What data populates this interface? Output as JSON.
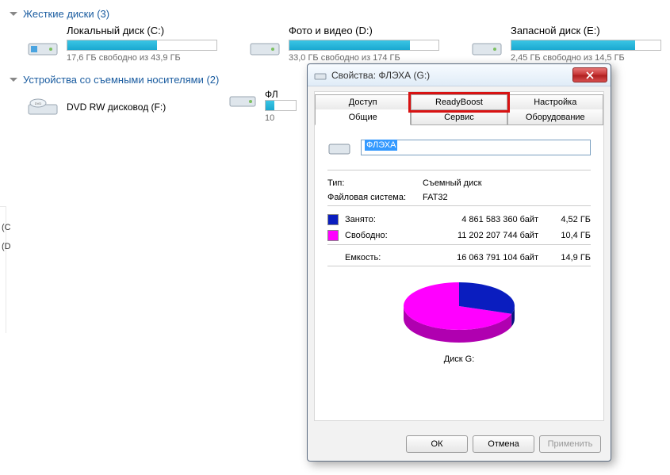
{
  "sections": {
    "hdd_header": "Жесткие диски (3)",
    "removable_header": "Устройства со съемными носителями (2)"
  },
  "drives": [
    {
      "label": "Локальный диск (C:)",
      "free": "17,6 ГБ свободно из 43,9 ГБ",
      "fill": 60
    },
    {
      "label": "Фото и видео (D:)",
      "free": "33,0 ГБ свободно из 174 ГБ",
      "fill": 81
    },
    {
      "label": "Запасной диск (E:)",
      "free": "2,45 ГБ свободно из 14,5 ГБ",
      "fill": 83
    }
  ],
  "dvd": {
    "label": "DVD RW дисковод (F:)"
  },
  "flash_bg": {
    "label_short": "ФЛ",
    "free_short": "10"
  },
  "left_letters": {
    "c": "(C",
    "d": "(D"
  },
  "dialog": {
    "title": "Свойства: ФЛЭХА (G:)",
    "tabs_row1": [
      "Доступ",
      "ReadyBoost",
      "Настройка"
    ],
    "tabs_row2": [
      "Общие",
      "Сервис",
      "Оборудование"
    ],
    "name_value": "ФЛЭХА",
    "type_label": "Тип:",
    "type_value": "Съемный диск",
    "fs_label": "Файловая система:",
    "fs_value": "FAT32",
    "used_label": "Занято:",
    "used_bytes": "4 861 583 360 байт",
    "used_gb": "4,52 ГБ",
    "free_label": "Свободно:",
    "free_bytes": "11 202 207 744 байт",
    "free_gb": "10,4 ГБ",
    "cap_label": "Емкость:",
    "cap_bytes": "16 063 791 104 байт",
    "cap_gb": "14,9 ГБ",
    "pie_label": "Диск G:",
    "buttons": {
      "ok": "ОК",
      "cancel": "Отмена",
      "apply": "Применить"
    }
  },
  "colors": {
    "used": "#0a1dbf",
    "free": "#ff00ff"
  },
  "chart_data": {
    "type": "pie",
    "title": "Диск G:",
    "series": [
      {
        "name": "Занято",
        "value": 4861583360,
        "value_gb": 4.52,
        "color": "#0a1dbf"
      },
      {
        "name": "Свободно",
        "value": 11202207744,
        "value_gb": 10.4,
        "color": "#ff00ff"
      }
    ],
    "total": 16063791104,
    "total_gb": 14.9
  }
}
